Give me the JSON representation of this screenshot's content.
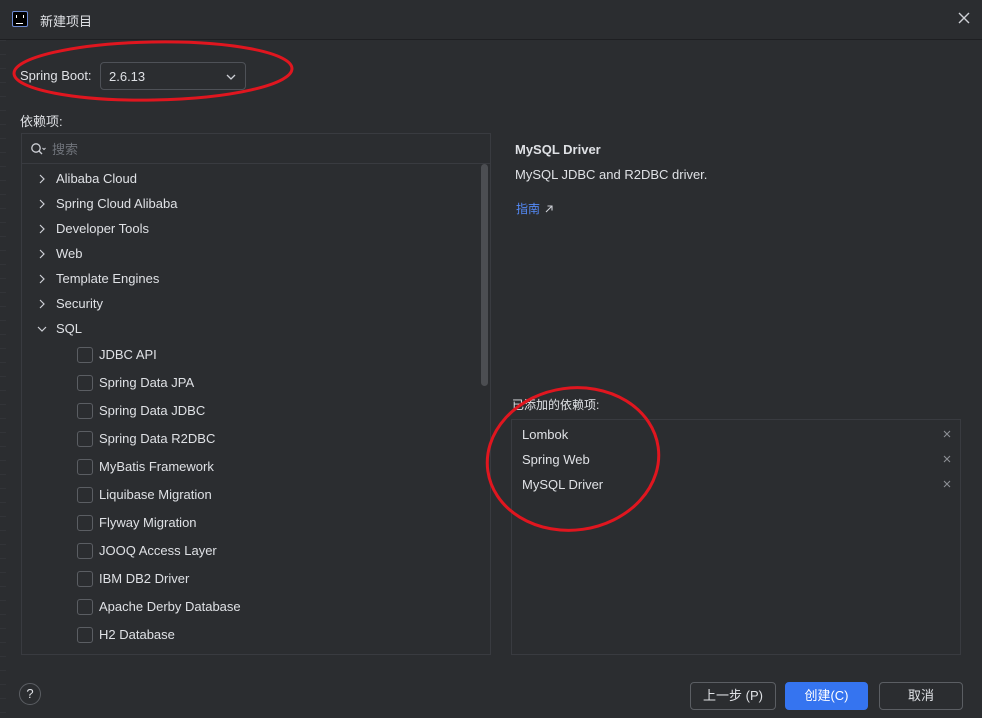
{
  "window": {
    "title": "新建项目",
    "close_icon": "close-icon"
  },
  "spring_boot": {
    "label": "Spring Boot:",
    "version": "2.6.13"
  },
  "dependencies": {
    "label": "依赖项:",
    "search_placeholder": "搜索",
    "categories": [
      {
        "label": "Alibaba Cloud",
        "expanded": false
      },
      {
        "label": "Spring Cloud Alibaba",
        "expanded": false
      },
      {
        "label": "Developer Tools",
        "expanded": false
      },
      {
        "label": "Web",
        "expanded": false
      },
      {
        "label": "Template Engines",
        "expanded": false
      },
      {
        "label": "Security",
        "expanded": false
      },
      {
        "label": "SQL",
        "expanded": true
      }
    ],
    "sql_items": [
      {
        "label": "JDBC API",
        "checked": false
      },
      {
        "label": "Spring Data JPA",
        "checked": false
      },
      {
        "label": "Spring Data JDBC",
        "checked": false
      },
      {
        "label": "Spring Data R2DBC",
        "checked": false
      },
      {
        "label": "MyBatis Framework",
        "checked": false
      },
      {
        "label": "Liquibase Migration",
        "checked": false
      },
      {
        "label": "Flyway Migration",
        "checked": false
      },
      {
        "label": "JOOQ Access Layer",
        "checked": false
      },
      {
        "label": "IBM DB2 Driver",
        "checked": false
      },
      {
        "label": "Apache Derby Database",
        "checked": false
      },
      {
        "label": "H2 Database",
        "checked": false
      }
    ]
  },
  "detail": {
    "title": "MySQL Driver",
    "description": "MySQL JDBC and R2DBC driver.",
    "guide_link": "指南"
  },
  "added": {
    "label": "已添加的依赖项:",
    "items": [
      "Lombok",
      "Spring Web",
      "MySQL Driver"
    ]
  },
  "footer": {
    "help": "?",
    "prev": "上一步 (P)",
    "create": "创建(C)",
    "cancel": "取消"
  },
  "colors": {
    "background": "#2b2d30",
    "accent": "#3574f0",
    "link": "#548af7",
    "annotation": "#e0161f"
  }
}
